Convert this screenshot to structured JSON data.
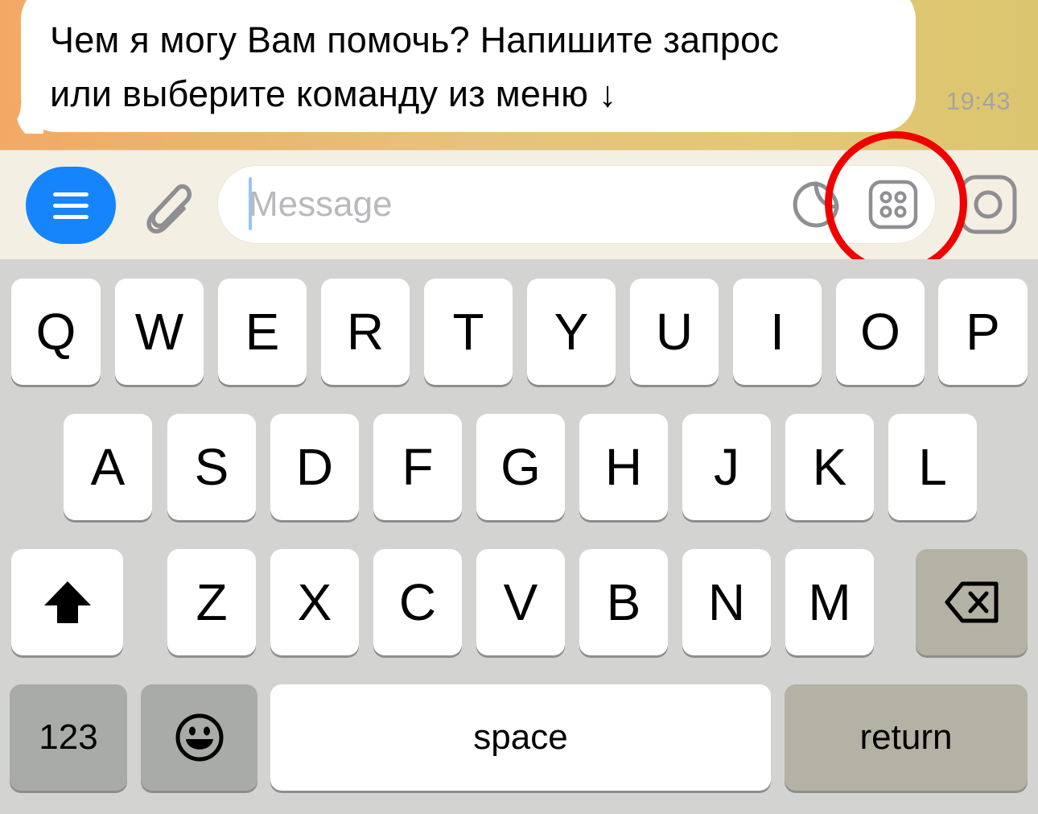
{
  "chat": {
    "message_line_1": "Чем я могу Вам помочь? Напишите запрос",
    "message_line_2": "или выберите команду из меню ↓",
    "time": "19:43"
  },
  "input_bar": {
    "placeholder": "Message",
    "menu_icon": "hamburger-menu-icon",
    "attach_icon": "paperclip-icon",
    "sticker_icon": "sticker-icon",
    "commands_icon": "bot-commands-icon",
    "camera_icon": "camera-icon",
    "highlight_color": "#f10000",
    "accent": "#1685fb"
  },
  "keyboard": {
    "row1": [
      "Q",
      "W",
      "E",
      "R",
      "T",
      "Y",
      "U",
      "I",
      "O",
      "P"
    ],
    "row2": [
      "A",
      "S",
      "D",
      "F",
      "G",
      "H",
      "J",
      "K",
      "L"
    ],
    "row3": [
      "Z",
      "X",
      "C",
      "V",
      "B",
      "N",
      "M"
    ],
    "numbers_label": "123",
    "space_label": "space",
    "return_label": "return",
    "shift_icon": "shift-icon",
    "backspace_icon": "backspace-icon",
    "emoji_icon": "emoji-icon"
  }
}
